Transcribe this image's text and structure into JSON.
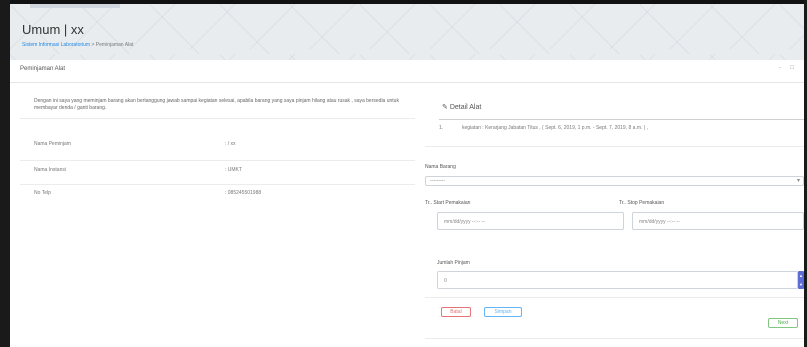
{
  "header": {
    "title": "Umum | xx",
    "breadcrumb_links": "Sistem Informasi Laboratorium",
    "breadcrumb_current": "Peminjaman Alat"
  },
  "panel": {
    "title": "Peminjaman Alat",
    "tools": "- □"
  },
  "left": {
    "notice": "Dengan ini saya yang meminjam barang akan bertanggung jawab sampai kegiatan selesai, apabila barang yang saya pinjam hilang atau rusak , saya bersedia untuk membayar denda / ganti barang.",
    "rows": [
      {
        "label": "Nama Peminjam",
        "value": ": / xx"
      },
      {
        "label": "Nama Instansi",
        "value": ": UMKT"
      },
      {
        "label": "No Telp",
        "value": ": 085245501988"
      }
    ]
  },
  "right": {
    "detail_title": "Detail Alat",
    "detail_row_num": "1.",
    "detail_row_text": "kegiatan : Kerarjang Jabatan Titus , ( Sept. 6, 2019, 1 p.m. - Sept. 7, 2019, 8 a.m. ) ,",
    "nama_barang_label": "Nama Barang",
    "nama_barang_value": "---------",
    "start_label": "Tr.. Start Pemakaian",
    "start_placeholder": "mm/dd/yyyy --:-- --",
    "stop_label": "Tr.. Stop Pemakaian",
    "stop_placeholder": "mm/dd/yyyy --:-- --",
    "jumlah_label": "Jumlah Pinjam",
    "jumlah_value": "0",
    "batal_label": "Batal",
    "simpan_label": "Simpan",
    "next_label": "Next"
  },
  "colors": {
    "header_bg": "#e9ecef",
    "link": "#1e88e5",
    "danger": "#e57373",
    "info": "#64b5f6",
    "success": "#4caf50",
    "spinner": "#5b6cd8"
  }
}
